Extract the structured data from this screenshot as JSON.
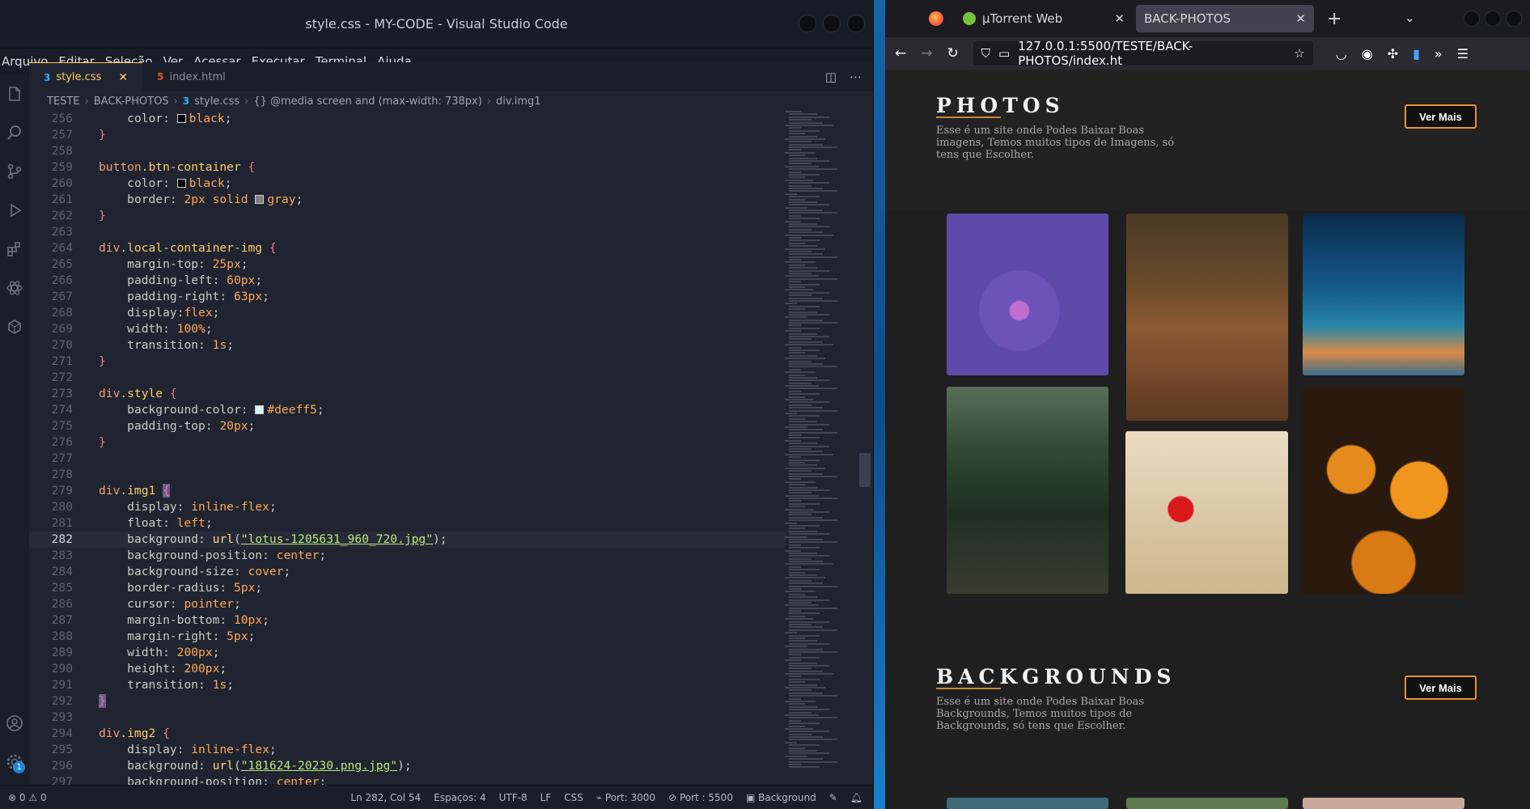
{
  "vscode": {
    "title": "style.css - MY-CODE - Visual Studio Code",
    "menu": [
      "Arquivo",
      "Editar",
      "Seleção",
      "Ver",
      "Acessar",
      "Executar",
      "Terminal",
      "Ajuda"
    ],
    "tabs": [
      {
        "label": "style.css",
        "active": true
      },
      {
        "label": "index.html",
        "active": false
      }
    ],
    "breadcrumb": [
      "TESTE",
      "BACK-PHOTOS",
      "style.css",
      "{} @media screen and (max-width: 738px)",
      "div.img1"
    ],
    "statusbar": {
      "errors": "0",
      "warnings": "0",
      "position": "Ln 282, Col 54",
      "spaces": "Espaços: 4",
      "encoding": "UTF-8",
      "eol": "LF",
      "language": "CSS",
      "port1": "Port: 3000",
      "port2": "Port : 5500",
      "background": "Background"
    },
    "badge_count": "1"
  },
  "code_lines": [
    {
      "n": "256",
      "html": "    <span class=\"prop\">color</span>: <span class=\"swatch\" style=\"background:#000\"></span><span class=\"val\">black</span>;"
    },
    {
      "n": "257",
      "html": "<span class=\"brace\">}</span>"
    },
    {
      "n": "258",
      "html": ""
    },
    {
      "n": "259",
      "html": "<span class=\"kw\">button</span><span class=\"cls\">.btn-container</span> <span class=\"brace\">{</span>"
    },
    {
      "n": "260",
      "html": "    <span class=\"prop\">color</span>: <span class=\"swatch\" style=\"background:#000\"></span><span class=\"val\">black</span>;"
    },
    {
      "n": "261",
      "html": "    <span class=\"prop\">border</span>: <span class=\"num\">2px</span> <span class=\"val\">solid</span> <span class=\"swatch\" style=\"background:#808080\"></span><span class=\"val\">gray</span>;"
    },
    {
      "n": "262",
      "html": "<span class=\"brace\">}</span>"
    },
    {
      "n": "263",
      "html": ""
    },
    {
      "n": "264",
      "html": "<span class=\"kw\">div</span><span class=\"cls\">.local-container-img</span> <span class=\"brace\">{</span>"
    },
    {
      "n": "265",
      "html": "    <span class=\"prop\">margin-top</span>: <span class=\"num\">25px</span>;"
    },
    {
      "n": "266",
      "html": "    <span class=\"prop\">padding-left</span>: <span class=\"num\">60px</span>;"
    },
    {
      "n": "267",
      "html": "    <span class=\"prop\">padding-right</span>: <span class=\"num\">63px</span>;"
    },
    {
      "n": "268",
      "html": "    <span class=\"prop\">display</span>:<span class=\"val\">flex</span>;"
    },
    {
      "n": "269",
      "html": "    <span class=\"prop\">width</span>: <span class=\"num\">100%</span>;"
    },
    {
      "n": "270",
      "html": "    <span class=\"prop\">transition</span>: <span class=\"num\">1s</span>;"
    },
    {
      "n": "271",
      "html": "<span class=\"brace\">}</span>"
    },
    {
      "n": "272",
      "html": ""
    },
    {
      "n": "273",
      "html": "<span class=\"kw\">div</span><span class=\"cls\">.style</span> <span class=\"brace\">{</span>"
    },
    {
      "n": "274",
      "html": "    <span class=\"prop\">background-color</span>: <span class=\"swatch\" style=\"background:#deeff5\"></span><span class=\"val\">#deeff5</span>;"
    },
    {
      "n": "275",
      "html": "    <span class=\"prop\">padding-top</span>: <span class=\"num\">20px</span>;"
    },
    {
      "n": "276",
      "html": "<span class=\"brace\">}</span>"
    },
    {
      "n": "277",
      "html": ""
    },
    {
      "n": "278",
      "html": ""
    },
    {
      "n": "279",
      "html": "<span class=\"kw\">div</span><span class=\"cls\">.img1</span> <span class=\"brace highlight-brace\">{</span>"
    },
    {
      "n": "280",
      "html": "    <span class=\"prop\">display</span>: <span class=\"val\">inline-flex</span>;"
    },
    {
      "n": "281",
      "html": "    <span class=\"prop\">float</span>: <span class=\"val\">left</span>;"
    },
    {
      "n": "282",
      "html": "    <span class=\"prop\">background</span>: <span class=\"fn\">url</span>(<span class=\"str\">\"lotus-1205631_960_720.jpg\"</span>);",
      "current": true
    },
    {
      "n": "283",
      "html": "    <span class=\"prop\">background-position</span>: <span class=\"val\">center</span>;"
    },
    {
      "n": "284",
      "html": "    <span class=\"prop\">background-size</span>: <span class=\"val\">cover</span>;"
    },
    {
      "n": "285",
      "html": "    <span class=\"prop\">border-radius</span>: <span class=\"num\">5px</span>;"
    },
    {
      "n": "286",
      "html": "    <span class=\"prop\">cursor</span>: <span class=\"val\">pointer</span>;"
    },
    {
      "n": "287",
      "html": "    <span class=\"prop\">margin-bottom</span>: <span class=\"num\">10px</span>;"
    },
    {
      "n": "288",
      "html": "    <span class=\"prop\">margin-right</span>: <span class=\"num\">5px</span>;"
    },
    {
      "n": "289",
      "html": "    <span class=\"prop\">width</span>: <span class=\"num\">200px</span>;"
    },
    {
      "n": "290",
      "html": "    <span class=\"prop\">height</span>: <span class=\"num\">200px</span>;"
    },
    {
      "n": "291",
      "html": "    <span class=\"prop\">transition</span>: <span class=\"num\">1s</span>;"
    },
    {
      "n": "292",
      "html": "<span class=\"brace highlight-brace\">}</span>"
    },
    {
      "n": "293",
      "html": ""
    },
    {
      "n": "294",
      "html": "<span class=\"kw\">div</span><span class=\"cls\">.img2</span> <span class=\"brace\">{</span>"
    },
    {
      "n": "295",
      "html": "    <span class=\"prop\">display</span>: <span class=\"val\">inline-flex</span>;"
    },
    {
      "n": "296",
      "html": "    <span class=\"prop\">background</span>: <span class=\"fn\">url</span>(<span class=\"str\">\"181624-20230.png.jpg\"</span>);"
    },
    {
      "n": "297",
      "html": "    <span class=\"prop\">background-position</span>: <span class=\"val\">center</span>;"
    }
  ],
  "firefox": {
    "tabs": [
      {
        "label": "µTorrent Web",
        "active": false
      },
      {
        "label": "BACK-PHOTOS",
        "active": true
      }
    ],
    "url": "127.0.0.1:5500/TESTE/BACK-PHOTOS/index.ht"
  },
  "page": {
    "photos": {
      "title": "PHOTOS",
      "desc": "Esse é um site onde Podes Baixar Boas imagens, Temos muitos tipos de Imagens, só tens que Escolher.",
      "button": "Ver Mais"
    },
    "backgrounds": {
      "title": "BACKGROUNDS",
      "desc": "Esse é um site onde Podes Baixar Boas Backgrounds, Temos muitos tipos de Backgrounds, só tens que Escolher.",
      "button": "Ver Mais"
    }
  }
}
